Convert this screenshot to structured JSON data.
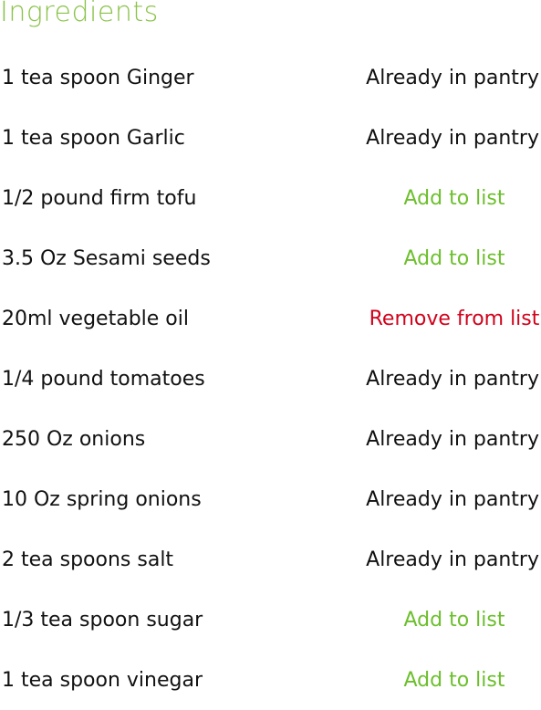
{
  "title": "Ingredients",
  "colors": {
    "title": "#8bc34a",
    "add": "#6cbf2c",
    "remove": "#d0021b",
    "text": "#111111"
  },
  "ingredients": [
    {
      "name": "1 tea spoon Ginger",
      "action": "Already in pantry",
      "status": "pantry"
    },
    {
      "name": "1 tea spoon Garlic",
      "action": "Already in pantry",
      "status": "pantry"
    },
    {
      "name": "1/2 pound firm tofu",
      "action": "Add to list",
      "status": "add"
    },
    {
      "name": "3.5 Oz Sesami seeds",
      "action": "Add to list",
      "status": "add"
    },
    {
      "name": "20ml vegetable oil",
      "action": "Remove from list",
      "status": "remove"
    },
    {
      "name": "1/4 pound tomatoes",
      "action": "Already in pantry",
      "status": "pantry"
    },
    {
      "name": "250 Oz onions",
      "action": "Already in pantry",
      "status": "pantry"
    },
    {
      "name": "10 Oz spring onions",
      "action": "Already in pantry",
      "status": "pantry"
    },
    {
      "name": "2 tea spoons salt",
      "action": "Already in pantry",
      "status": "pantry"
    },
    {
      "name": "1/3 tea spoon sugar",
      "action": "Add to list",
      "status": "add"
    },
    {
      "name": "1 tea spoon vinegar",
      "action": "Add to list",
      "status": "add"
    }
  ]
}
